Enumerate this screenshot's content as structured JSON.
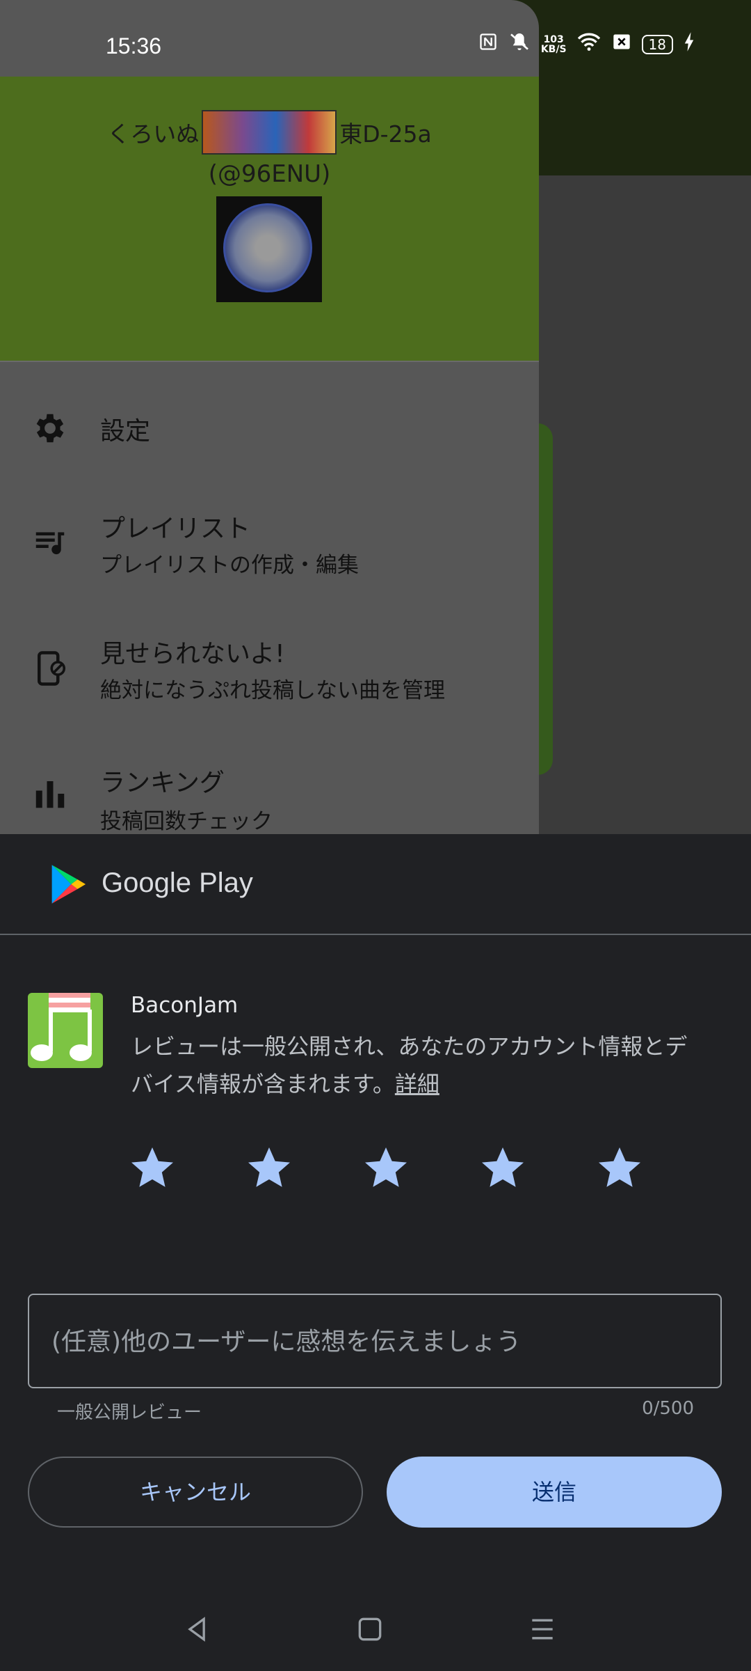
{
  "status_bar": {
    "time": "15:36",
    "speed_value": "103",
    "speed_unit": "KB/S",
    "battery_level": "18",
    "icons": [
      "nfc-icon",
      "mute-icon",
      "wifi-icon",
      "sim-off-icon",
      "battery-icon",
      "charging-icon"
    ]
  },
  "drawer": {
    "name_prefix": "くろいぬ",
    "name_suffix": "東D-25a",
    "handle": "(@96ENU)",
    "menu": [
      {
        "icon": "gear-icon",
        "title": "設定",
        "subtitle": ""
      },
      {
        "icon": "playlist-icon",
        "title": "プレイリスト",
        "subtitle": "プレイリストの作成・編集"
      },
      {
        "icon": "device-block-icon",
        "title": "見せられないよ!",
        "subtitle": "絶対になうぷれ投稿しない曲を管理"
      },
      {
        "icon": "bar-chart-icon",
        "title": "ランキング",
        "subtitle": "投稿回数チェック"
      }
    ]
  },
  "review_sheet": {
    "store_name": "Google Play",
    "app_name": "BaconJam",
    "description": "レビューは一般公開され、あなたのアカウント情報とデバイス情報が含まれます。",
    "detail_link": "詳細",
    "star_count": 5,
    "stars_selected": 0,
    "star_color": "#a8c7fa",
    "review_placeholder": "(任意)他のユーザーに感想を伝えましょう",
    "review_value": "",
    "helper_text": "一般公開レビュー",
    "counter": "0/500",
    "cancel_label": "キャンセル",
    "submit_label": "送信"
  },
  "colors": {
    "accent": "#a8c7fa",
    "sheet_bg": "#202124",
    "drawer_header": "#4d6d1d"
  }
}
